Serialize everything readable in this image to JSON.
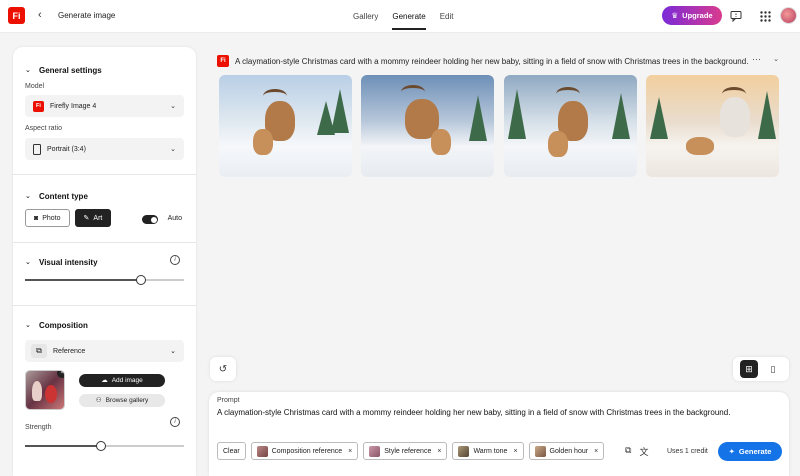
{
  "header": {
    "logo_text": "Fi",
    "back_icon": "chevron-left-icon",
    "title": "Generate image",
    "tabs": [
      {
        "label": "Gallery",
        "active": false
      },
      {
        "label": "Generate",
        "active": true
      },
      {
        "label": "Edit",
        "active": false
      }
    ],
    "upgrade_label": "Upgrade",
    "upgrade_icon": "crown-icon",
    "icons": [
      "chat-icon",
      "apps-grid-icon",
      "avatar"
    ]
  },
  "sidebar": {
    "general_settings": {
      "heading": "General settings",
      "model_label": "Model",
      "model_value": "Firefly Image 4",
      "model_icon_text": "Fi",
      "aspect_label": "Aspect ratio",
      "aspect_value": "Portrait (3:4)"
    },
    "content_type": {
      "heading": "Content type",
      "photo_label": "Photo",
      "art_label": "Art",
      "art_selected": true,
      "auto_label": "Auto",
      "auto_on": true
    },
    "visual_intensity": {
      "heading": "Visual intensity",
      "value_fraction": 0.73
    },
    "composition": {
      "heading": "Composition",
      "reference_label": "Reference",
      "add_image_label": "Add image",
      "browse_gallery_label": "Browse gallery",
      "strength_label": "Strength",
      "strength_fraction": 0.48
    }
  },
  "main": {
    "prompt_title": "A claymation-style Christmas card with a mommy reindeer holding her new baby, sitting in a field of snow with Christmas trees in the background.",
    "prompt_logo_text": "Fi",
    "images": [
      {
        "name": "generated-image-1"
      },
      {
        "name": "generated-image-2"
      },
      {
        "name": "generated-image-3"
      },
      {
        "name": "generated-image-4"
      }
    ]
  },
  "prompt_box": {
    "label": "Prompt",
    "text": "A claymation-style Christmas card with a mommy reindeer holding her new baby, sitting in a field of snow with Christmas trees in the background.",
    "clear_label": "Clear",
    "chips": [
      {
        "label": "Composition reference",
        "color": "#8a6a6a"
      },
      {
        "label": "Style reference",
        "color": "#9a7a8a"
      },
      {
        "label": "Warm tone",
        "color": "#7a6a4a"
      },
      {
        "label": "Golden hour",
        "color": "#8a6a3a"
      }
    ],
    "credits_label": "Uses 1 credit",
    "generate_label": "Generate"
  },
  "colors": {
    "accent_blue": "#1473e6",
    "adobe_red": "#eb1000",
    "upgrade_gradient_start": "#7a2ad8",
    "upgrade_gradient_end": "#d93b8e"
  }
}
